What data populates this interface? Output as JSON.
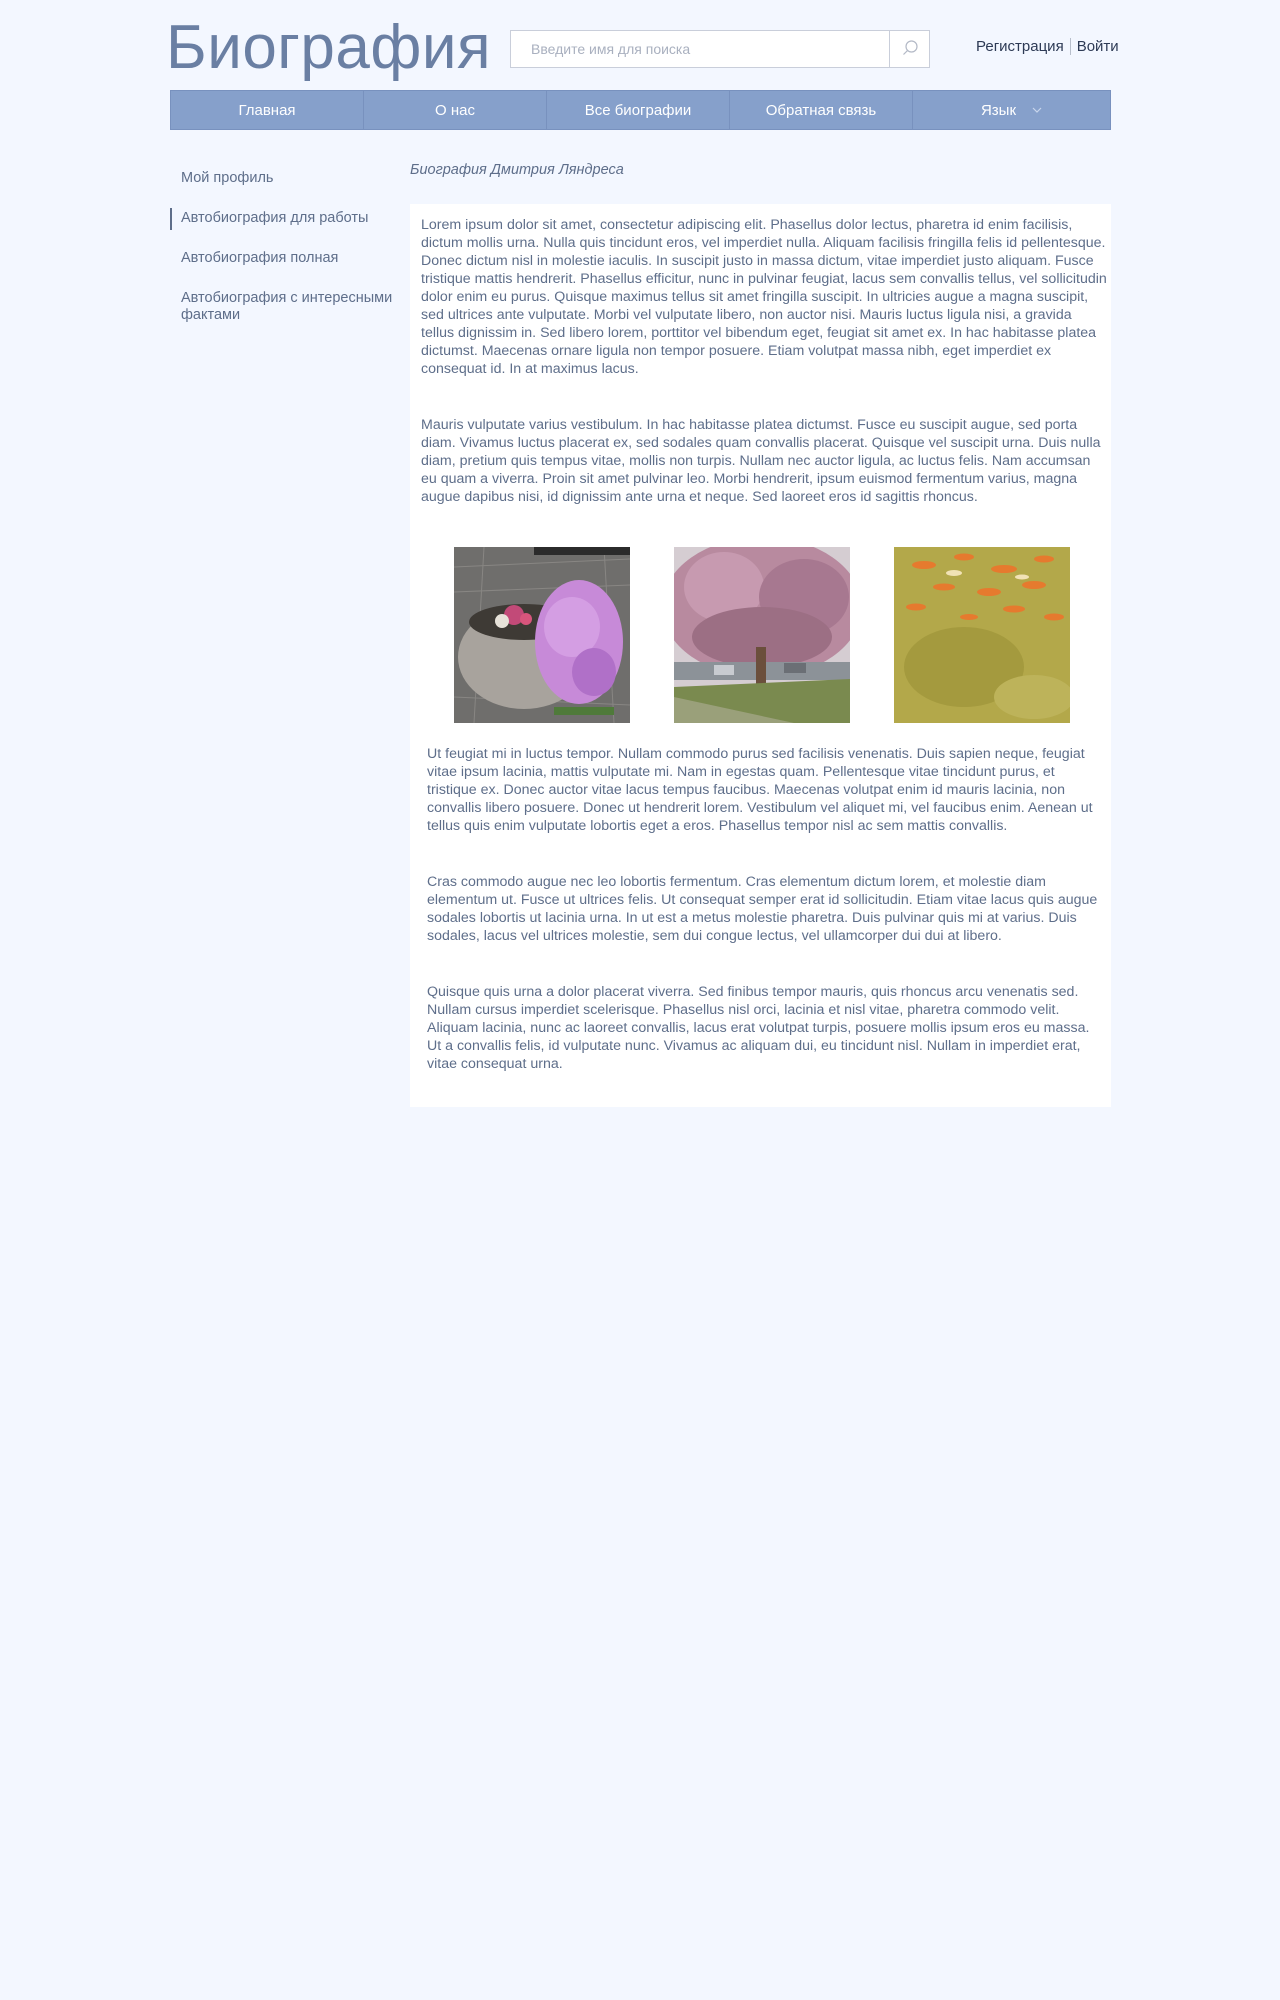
{
  "header": {
    "site_title": "Биография",
    "search_placeholder": "Введите имя для поиска",
    "auth": {
      "register": "Регистрация",
      "login": "Войти"
    }
  },
  "nav": {
    "items": [
      {
        "label": "Главная"
      },
      {
        "label": "О нас"
      },
      {
        "label": "Все биографии"
      },
      {
        "label": "Обратная связь"
      },
      {
        "label": "Язык"
      }
    ]
  },
  "sidebar": {
    "items": [
      {
        "label": "Мой профиль",
        "active": false
      },
      {
        "label": "Автобиография для работы",
        "active": true
      },
      {
        "label": "Автобиография полная",
        "active": false
      },
      {
        "label": "Автобиография с интересными фактами",
        "active": false
      }
    ]
  },
  "main": {
    "title": "Биография Дмитрия Ляндреса",
    "paragraphs": [
      "Lorem ipsum dolor sit amet, consectetur adipiscing elit. Phasellus dolor lectus, pharetra id enim facilisis, dictum mollis urna. Nulla quis tincidunt eros, vel imperdiet nulla. Aliquam facilisis fringilla felis id pellentesque. Donec dictum nisl in molestie iaculis. In suscipit justo in massa dictum, vitae imperdiet justo aliquam. Fusce tristique mattis hendrerit. Phasellus efficitur, nunc in pulvinar feugiat, lacus sem convallis tellus, vel sollicitudin dolor enim eu purus. Quisque maximus tellus sit amet fringilla suscipit. In ultricies augue a magna suscipit, sed ultrices ante vulputate. Morbi vel vulputate libero, non auctor nisi. Mauris luctus ligula nisi, a gravida tellus dignissim in. Sed libero lorem, porttitor vel bibendum eget, feugiat sit amet ex. In hac habitasse platea dictumst. Maecenas ornare ligula non tempor posuere. Etiam volutpat massa nibh, eget imperdiet ex consequat id. In at maximus lacus.",
      "Mauris vulputate varius vestibulum. In hac habitasse platea dictumst. Fusce eu suscipit augue, sed porta diam. Vivamus luctus placerat ex, sed sodales quam convallis placerat. Quisque vel suscipit urna. Duis nulla diam, pretium quis tempus vitae, mollis non turpis. Nullam nec auctor ligula, ac luctus felis. Nam accumsan eu quam a viverra. Proin sit amet pulvinar leo. Morbi hendrerit, ipsum euismod fermentum varius, magna augue dapibus nisi, id dignissim ante urna et neque. Sed laoreet eros id sagittis rhoncus.",
      "Ut feugiat mi in luctus tempor. Nullam commodo purus sed facilisis venenatis. Duis sapien neque, feugiat vitae ipsum lacinia, mattis vulputate mi. Nam in egestas quam. Pellentesque vitae tincidunt purus, et tristique ex. Donec auctor vitae lacus tempus faucibus. Maecenas volutpat enim id mauris lacinia, non convallis libero posuere. Donec ut hendrerit lorem. Vestibulum vel aliquet mi, vel faucibus enim. Aenean ut tellus quis enim vulputate lobortis eget a eros. Phasellus tempor nisl ac sem mattis convallis.",
      "Cras commodo augue nec leo lobortis fermentum. Cras elementum dictum lorem, et molestie diam elementum ut. Fusce ut ultrices felis. Ut consequat semper erat id sollicitudin. Etiam vitae lacus quis augue sodales lobortis ut lacinia urna. In ut est a metus molestie pharetra. Duis pulvinar quis mi at varius. Duis sodales, lacus vel ultrices molestie, sem dui congue lectus, vel ullamcorper dui dui at libero.",
      "Quisque quis urna a dolor placerat viverra. Sed finibus tempor mauris, quis rhoncus arcu venenatis sed. Nullam cursus imperdiet scelerisque. Phasellus nisl orci, lacinia et nisl vitae, pharetra commodo velit. Aliquam lacinia, nunc ac laoreet convallis, lacus erat volutpat turpis, posuere mollis ipsum eros eu massa. Ut a convallis felis, id vulputate nunc. Vivamus ac aliquam dui, eu tincidunt nisl. Nullam in imperdiet erat, vitae consequat urna."
    ],
    "gallery": [
      {
        "subject": "flower-planter"
      },
      {
        "subject": "blossoming-tree"
      },
      {
        "subject": "koi-pond"
      }
    ]
  },
  "colors": {
    "page_bg": "#f3f7ff",
    "nav_bg": "#86a0cb",
    "text": "#5e6e8a",
    "title": "#6a7fa3"
  }
}
